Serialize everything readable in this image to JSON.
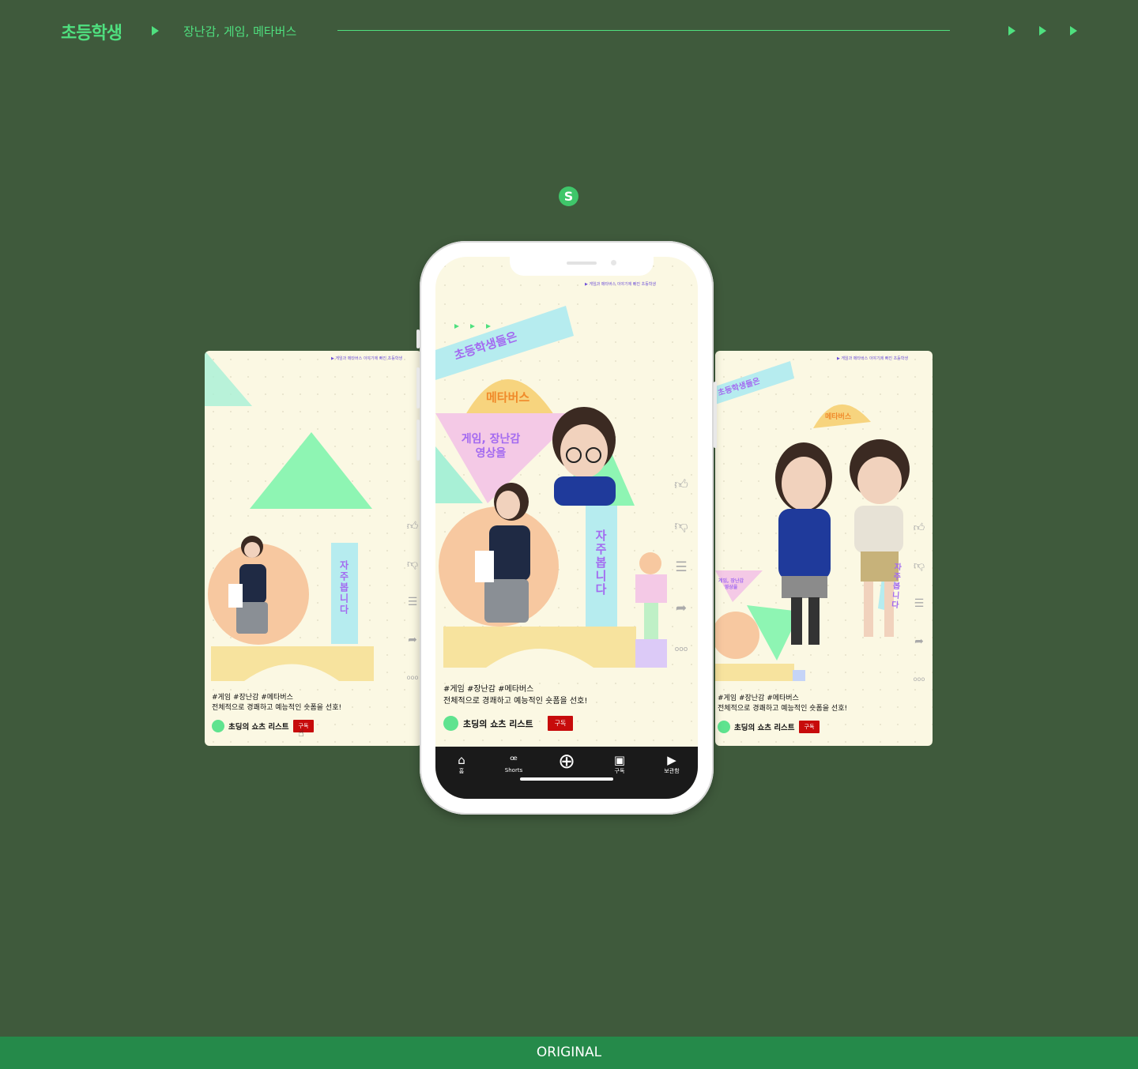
{
  "header": {
    "brand": "초등학생",
    "subtitle": "장난감, 게임, 메타버스"
  },
  "badge": "S",
  "card_common": {
    "top_note": "▶ 게임과 메타버스 이야기에 빠진 초등학생",
    "hashtags": "#게임 #장난감 #메타버스",
    "description": "전체적으로 경쾌하고 예능적인 숏폼을 선호!",
    "channel": "초딩의 쇼츠 리스트",
    "subscribe": "구독"
  },
  "phone": {
    "banner_top": "초등학생들은",
    "banner_meta": "메타버스",
    "banner_game": "게임, 장난감\n영상을",
    "banner_often": "자주봅니다",
    "nav": [
      {
        "icon": "⌂",
        "label": "홈"
      },
      {
        "icon": "ꟹ",
        "label": "Shorts"
      },
      {
        "icon": "⊕",
        "label": ""
      },
      {
        "icon": "▣",
        "label": "구독"
      },
      {
        "icon": "▶",
        "label": "보관함"
      }
    ]
  },
  "left_card": {
    "often": "자주봅니다"
  },
  "right_card": {
    "top": "초등학생들은",
    "meta": "메타버스",
    "game": "게임, 장난감\n영상을",
    "often": "자주봅니다"
  },
  "footer": "ORIGINAL",
  "colors": {
    "bg": "#3f5a3c",
    "accent": "#4fe07f",
    "footer": "#258a4a",
    "subscribe": "#c70b0b"
  }
}
